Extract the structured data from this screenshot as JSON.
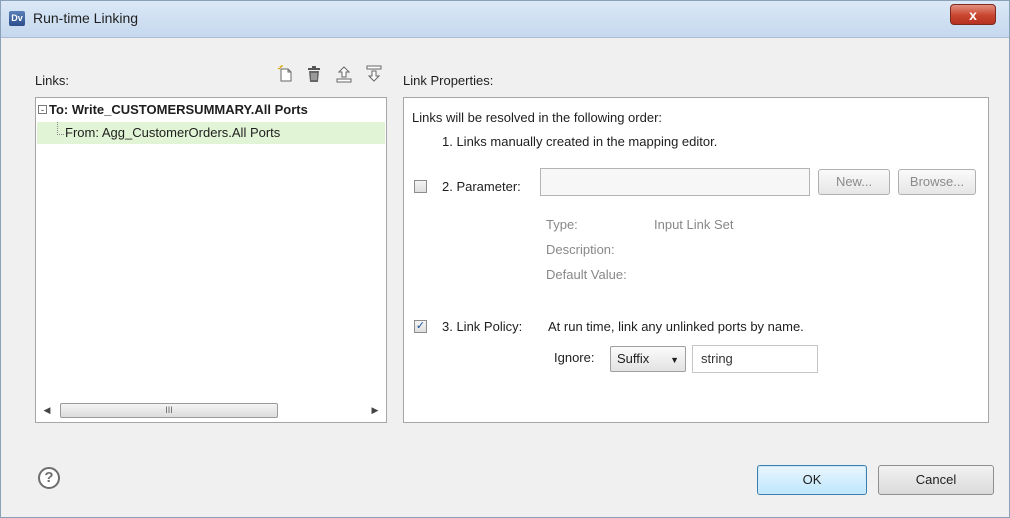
{
  "window": {
    "title": "Run-time Linking",
    "app_badge": "Dv",
    "close_glyph": "x"
  },
  "links": {
    "label": "Links:",
    "toolbar": [
      "new-link-icon",
      "delete-icon",
      "move-up-icon",
      "move-down-icon"
    ],
    "tree": {
      "root_toggle": "-",
      "root": "To: Write_CUSTOMERSUMMARY.All Ports",
      "child": "From: Agg_CustomerOrders.All Ports"
    },
    "scrollbar": {
      "left": "◀",
      "right": "▶",
      "thumb": "III"
    }
  },
  "properties": {
    "label": "Link Properties:",
    "intro": "Links will be resolved in the following order:",
    "item1": "1. Links manually created in the mapping editor.",
    "parameter": {
      "checked": false,
      "label": "2. Parameter:",
      "value": "",
      "new_button": "New...",
      "browse_button": "Browse...",
      "type_label": "Type:",
      "type_value": "Input Link Set",
      "description_label": "Description:",
      "default_label": "Default Value:"
    },
    "policy": {
      "checked": true,
      "check_glyph": "✓",
      "label": "3. Link Policy:",
      "text": "At run time, link any unlinked ports by name.",
      "ignore_label": "Ignore:",
      "ignore_option": "Suffix",
      "ignore_caret": "▼",
      "ignore_value": "string"
    }
  },
  "footer": {
    "help": "?",
    "ok": "OK",
    "cancel": "Cancel"
  },
  "colors": {
    "selected_row": "#e2f4d6",
    "accent": "#3c7fb1"
  }
}
